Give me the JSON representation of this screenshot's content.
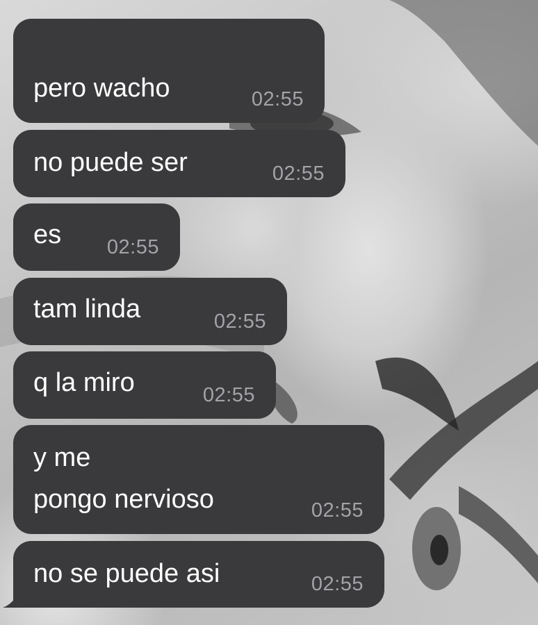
{
  "conversation": {
    "messages": [
      {
        "text": "pero wacho",
        "time": "02:55"
      },
      {
        "text": "no puede ser",
        "time": "02:55"
      },
      {
        "text": "es",
        "time": "02:55"
      },
      {
        "text": "tam linda",
        "time": "02:55"
      },
      {
        "text": "q la miro",
        "time": "02:55"
      },
      {
        "text": "y me\npongo nervioso",
        "line1": "y me",
        "line2": "pongo nervioso",
        "time": "02:55"
      },
      {
        "text": "no se puede asi",
        "time": "02:55"
      }
    ]
  },
  "colors": {
    "bubble": "#3a3a3c",
    "message_text": "#ffffff",
    "timestamp": "#a3a3a8"
  },
  "background": {
    "kind": "grayscale photo wallpaper"
  }
}
